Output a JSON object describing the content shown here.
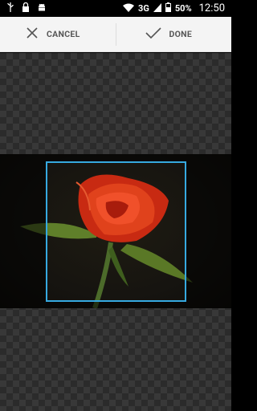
{
  "status_bar": {
    "network": "3G",
    "battery": "50%",
    "time": "12:50"
  },
  "action_bar": {
    "cancel_label": "CANCEL",
    "done_label": "DONE"
  },
  "accent_color": "#36a9e0"
}
